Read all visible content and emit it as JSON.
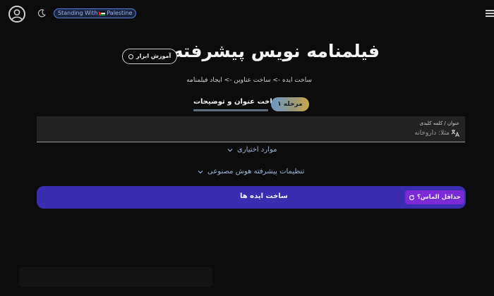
{
  "header": {
    "badge_prefix": "Standing With",
    "badge_suffix": "Palestine"
  },
  "main": {
    "title": "فیلمنامه نویس پیشرفته",
    "tutorial_label": "آموزش ابزار",
    "steps_line": "ساخت ایده -> ساخت عناوین -> ایجاد فیلمنامه",
    "stage": {
      "pill_label": "مرحله ۱",
      "title": "ساخت عنوان و توضیحات"
    },
    "input": {
      "label": "عنوان / کلمه کلیدی",
      "placeholder": "مثلا: داروخانه",
      "value": ""
    },
    "optional_label": "موارد اختیاری",
    "ai_settings_label": "تنظیمات پیشرفته هوش مصنوعی",
    "action_label": "ساخت ایده ها",
    "diamond_label": "حداقل الماس؟"
  },
  "colors": {
    "accent": "#3a2db0",
    "diamond": "#7a2bd6",
    "link": "#9fb5d8"
  }
}
